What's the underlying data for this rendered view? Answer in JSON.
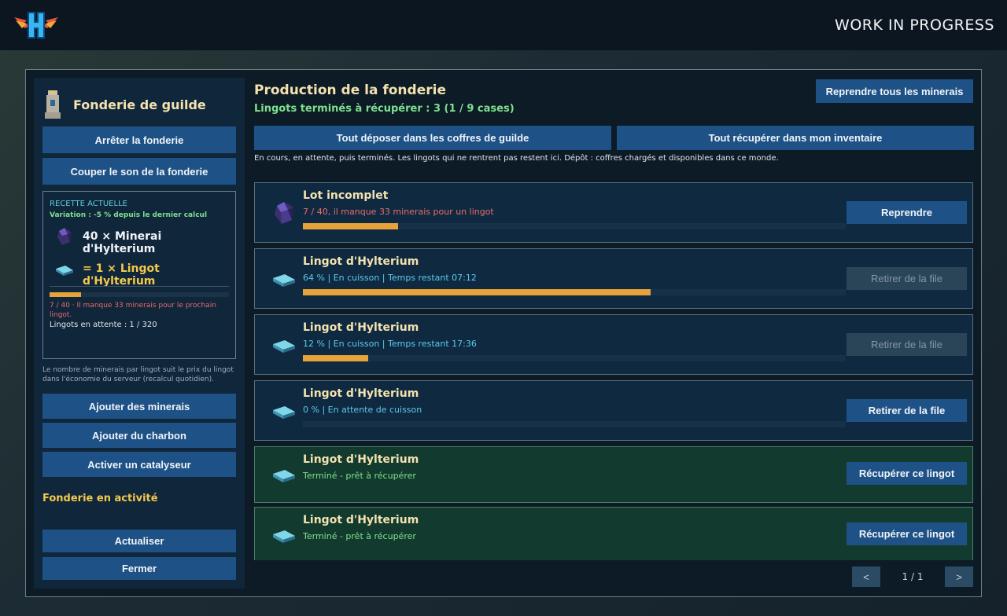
{
  "header": {
    "title": "WORK IN PROGRESS",
    "logo": "winged-h-logo"
  },
  "sidebar": {
    "title": "Fonderie de guilde",
    "icon": "furnace-tower-icon",
    "stop_button": "Arrêter la fonderie",
    "mute_button": "Couper le son de la fonderie",
    "recipe": {
      "label": "RECETTE ACTUELLE",
      "variation": "Variation : -5 % depuis le dernier calcul",
      "input": "40 × Minerai d'Hylterium",
      "output": "= 1 × Lingot d'Hylterium",
      "progress_fraction": 0.175,
      "missing": "7 / 40  ·  Il manque 33 minerais pour le prochain lingot.",
      "waiting": "Lingots en attente : 1 / 320"
    },
    "note": "Le nombre de minerais par lingot suit le prix du lingot dans l'économie du serveur (recalcul quotidien).",
    "add_minerals": "Ajouter des minerais",
    "add_coal": "Ajouter du charbon",
    "activate_catalyst": "Activer un catalyseur",
    "status": "Fonderie en activité",
    "refresh": "Actualiser",
    "close": "Fermer"
  },
  "main": {
    "title": "Production de la fonderie",
    "subtitle": "Lingots terminés à récupérer : 3  (1 / 9 cases)",
    "reclaim_all": "Reprendre tous les minerais",
    "deposit_all": "Tout déposer dans les coffres de guilde",
    "retrieve_all": "Tout récupérer dans mon inventaire",
    "description": "En cours, en attente, puis terminés. Les lingots qui ne rentrent pas restent ici. Dépôt : coffres chargés et disponibles dans ce monde.",
    "items": [
      {
        "name": "Lot incomplet",
        "info": "7 / 40, il manque 33 minerais pour un lingot",
        "info_color": "#e96a6a",
        "progress": 0.175,
        "action": "Reprendre",
        "icon": "ore-crystal-icon"
      },
      {
        "name": "Lingot d'Hylterium",
        "info": "64 %  |  En cuisson  |  Temps restant 07:12",
        "info_color": "#5cc8ee",
        "progress": 0.64,
        "action": "Retirer de la file",
        "icon": "ingot-icon"
      },
      {
        "name": "Lingot d'Hylterium",
        "info": "12 %  |  En cuisson  |  Temps restant 17:36",
        "info_color": "#5cc8ee",
        "progress": 0.12,
        "action": "Retirer de la file",
        "icon": "ingot-icon"
      },
      {
        "name": "Lingot d'Hylterium",
        "info": "0 %  |  En attente de cuisson",
        "info_color": "#5cc8ee",
        "progress": 0,
        "action": "Retirer de la file",
        "icon": "ingot-icon"
      },
      {
        "name": "Lingot d'Hylterium",
        "info": "Terminé - prêt à récupérer",
        "info_color": "#7ee08e",
        "action": "Récupérer ce lingot",
        "icon": "ingot-icon"
      },
      {
        "name": "Lingot d'Hylterium",
        "info": "Terminé - prêt à récupérer",
        "info_color": "#7ee08e",
        "action": "Récupérer ce lingot",
        "icon": "ingot-icon"
      }
    ],
    "pager": {
      "prev": "<",
      "page": "1 / 1",
      "next": ">"
    }
  },
  "colors": {
    "accent_button": "#1e5286",
    "title_gold": "#f4e2b0",
    "success_green": "#7ee08e",
    "progress_orange": "#e7a23b"
  }
}
